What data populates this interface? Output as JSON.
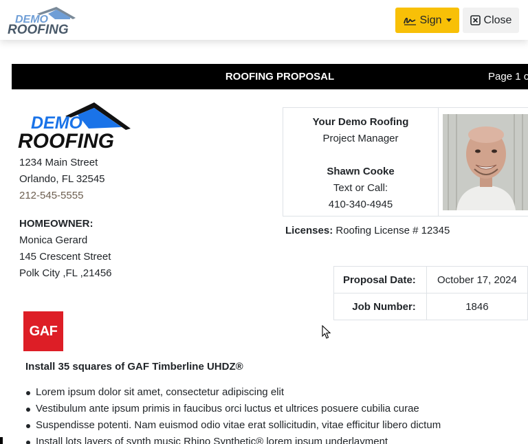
{
  "app": {
    "brand_word1": "DEMO",
    "brand_word2": "ROOFING",
    "sign_label": "Sign",
    "close_label": "Close"
  },
  "header": {
    "title": "ROOFING PROPOSAL",
    "page": "Page 1 o"
  },
  "company": {
    "logo_word1": "DEMO",
    "logo_word2": "ROOFING",
    "street": "1234 Main Street",
    "city": "Orlando, FL 32545",
    "phone": "212-545-5555"
  },
  "homeowner": {
    "label": "HOMEOWNER:",
    "name": "Monica Gerard",
    "street": "145 Crescent Street",
    "city": "Polk City ,FL ,21456"
  },
  "contact": {
    "company": "Your Demo Roofing",
    "role": "Project Manager",
    "name": "Shawn Cooke",
    "call_label": "Text or Call:",
    "phone": "410-340-4945"
  },
  "licenses": {
    "label": "Licenses:",
    "value": "Roofing License # 12345"
  },
  "proposal": {
    "date_label": "Proposal Date:",
    "date_value": "October 17, 2024",
    "job_label": "Job Number:",
    "job_value": "1846"
  },
  "product": {
    "badge": "GAF",
    "title": "Install 35 squares of GAF Timberline UHDZ®",
    "bullets": [
      "Lorem ipsum dolor sit amet, consectetur adipiscing elit",
      "Vestibulum ante ipsum primis in faucibus orci luctus et ultrices posuere cubilia curae",
      "Suspendisse potenti. Nam euismod odio vitae erat sollicitudin, vitae efficitur libero dictum",
      "Install lots layers of synth music Rhino Synthetic® lorem ipsum underlayment"
    ]
  },
  "colors": {
    "sign_button": "#f8c007",
    "logo_blue": "#1a73e8",
    "gaf_red": "#dd1e26",
    "header_bar": "#000000"
  }
}
